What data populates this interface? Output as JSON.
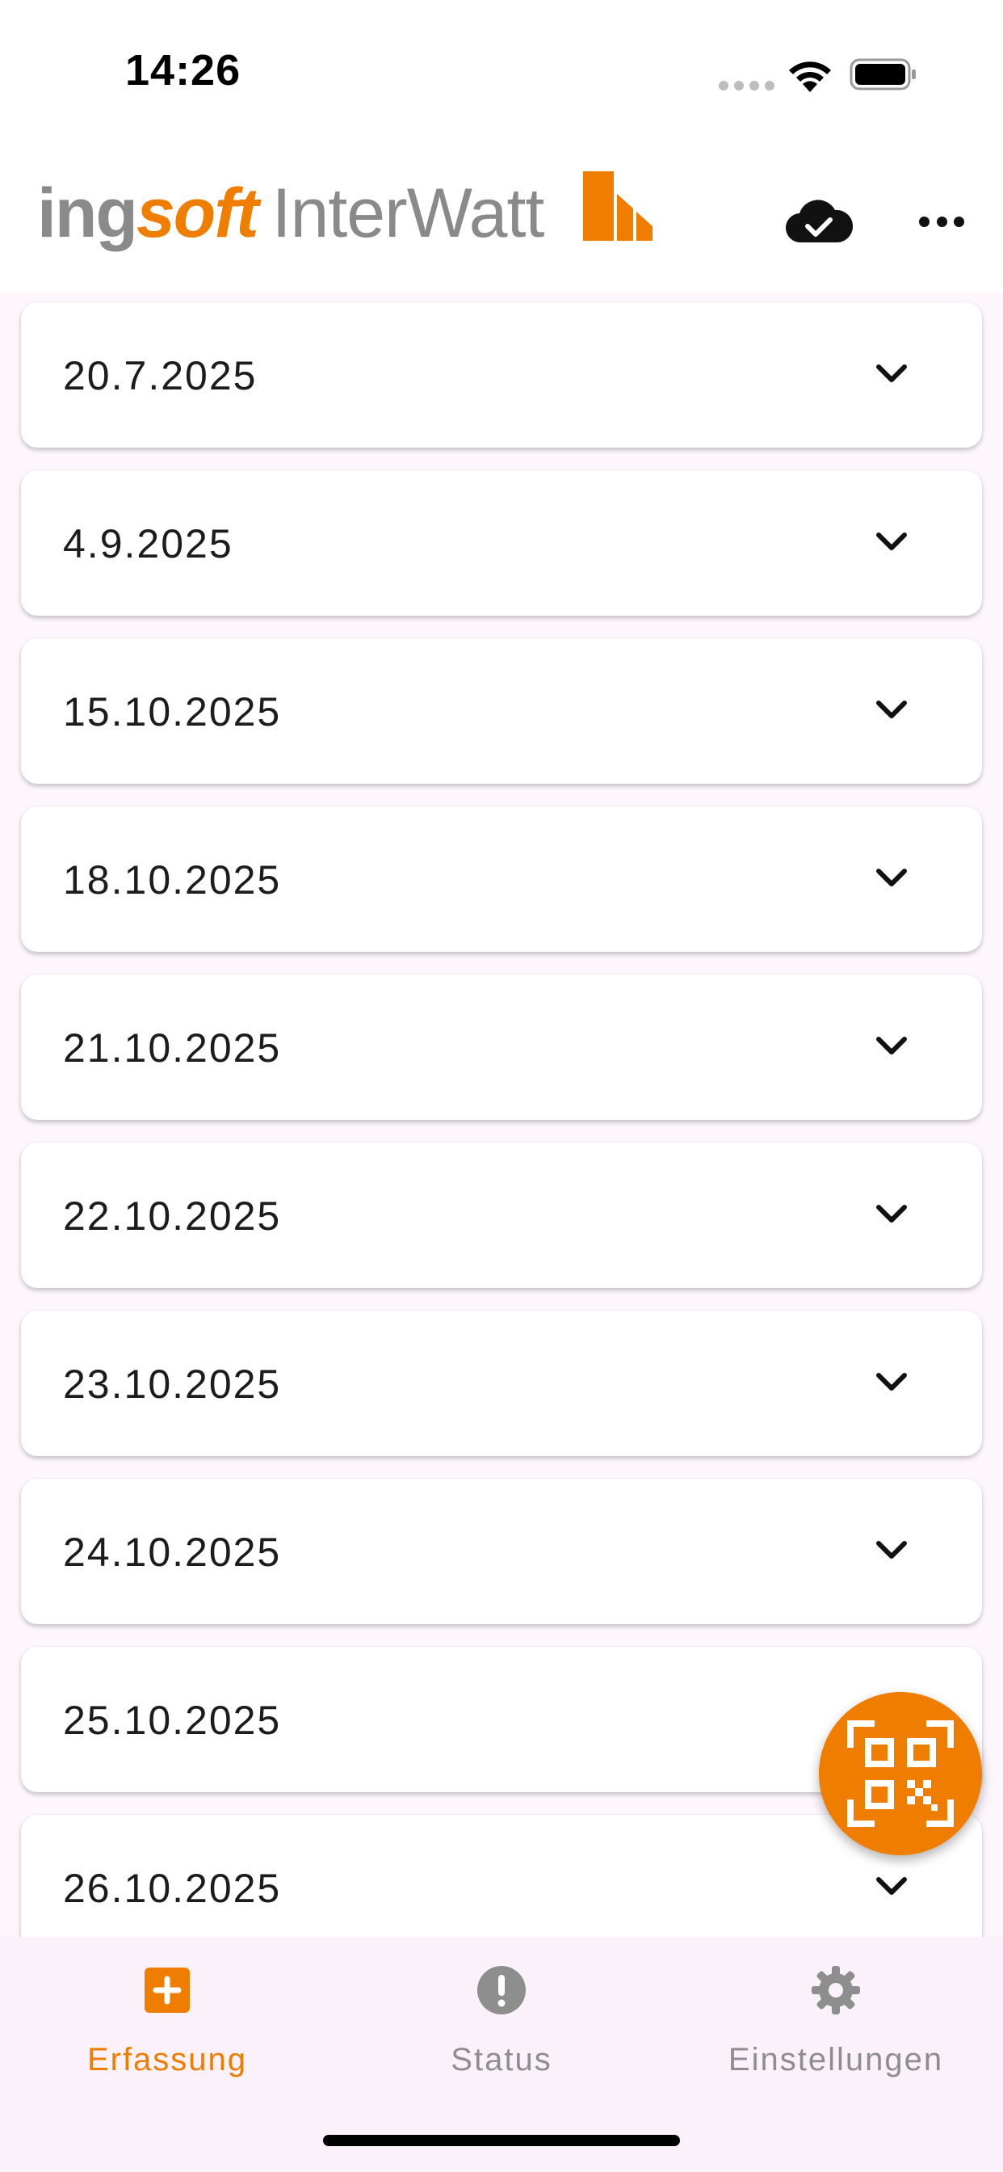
{
  "status_bar": {
    "time": "14:26"
  },
  "header": {
    "logo": {
      "part1": "ing",
      "part2": "soft",
      "part3": "InterWatt"
    },
    "icons": {
      "cloud": "cloud-check-icon",
      "more": "more-horizontal-icon"
    }
  },
  "list": {
    "items": [
      {
        "date": "20.7.2025"
      },
      {
        "date": "4.9.2025"
      },
      {
        "date": "15.10.2025"
      },
      {
        "date": "18.10.2025"
      },
      {
        "date": "21.10.2025"
      },
      {
        "date": "22.10.2025"
      },
      {
        "date": "23.10.2025"
      },
      {
        "date": "24.10.2025"
      },
      {
        "date": "25.10.2025"
      },
      {
        "date": "26.10.2025"
      }
    ]
  },
  "fab": {
    "icon": "qr-code-scan-icon"
  },
  "bottom_nav": {
    "items": [
      {
        "label": "Erfassung",
        "icon": "add-box-icon",
        "active": true
      },
      {
        "label": "Status",
        "icon": "alert-circle-icon",
        "active": false
      },
      {
        "label": "Einstellungen",
        "icon": "gear-icon",
        "active": false
      }
    ]
  },
  "colors": {
    "accent": "#ef7d00",
    "inactive": "#8e8e8e",
    "text": "#1c1b1f",
    "nav_bg": "#faf1fa"
  }
}
